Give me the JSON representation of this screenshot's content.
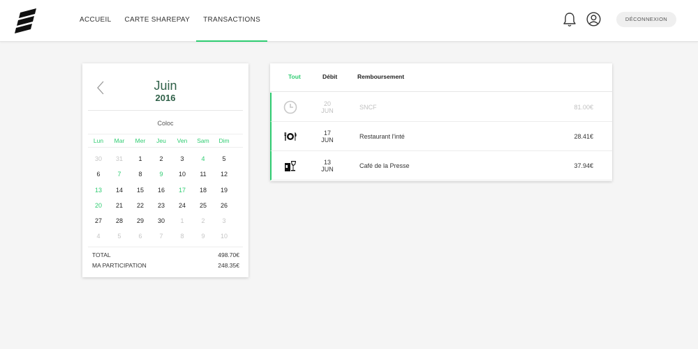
{
  "header": {
    "nav": [
      {
        "label": "ACCUEIL",
        "active": false
      },
      {
        "label": "CARTE SHAREPAY",
        "active": false
      },
      {
        "label": "TRANSACTIONS",
        "active": true
      }
    ],
    "logout_label": "DÉCONNEXION",
    "accent": "#2ecc71"
  },
  "calendar": {
    "month": "Juin",
    "year": "2016",
    "group": "Coloc",
    "weekdays": [
      "Lun",
      "Mar",
      "Mer",
      "Jeu",
      "Ven",
      "Sam",
      "Dim"
    ],
    "weeks": [
      [
        {
          "d": "30",
          "s": "muted"
        },
        {
          "d": "31",
          "s": "muted"
        },
        {
          "d": "1",
          "s": ""
        },
        {
          "d": "2",
          "s": ""
        },
        {
          "d": "3",
          "s": ""
        },
        {
          "d": "4",
          "s": "green"
        },
        {
          "d": "5",
          "s": ""
        }
      ],
      [
        {
          "d": "6",
          "s": ""
        },
        {
          "d": "7",
          "s": "green"
        },
        {
          "d": "8",
          "s": ""
        },
        {
          "d": "9",
          "s": "green"
        },
        {
          "d": "10",
          "s": ""
        },
        {
          "d": "11",
          "s": ""
        },
        {
          "d": "12",
          "s": ""
        }
      ],
      [
        {
          "d": "13",
          "s": "green"
        },
        {
          "d": "14",
          "s": ""
        },
        {
          "d": "15",
          "s": ""
        },
        {
          "d": "16",
          "s": ""
        },
        {
          "d": "17",
          "s": "green"
        },
        {
          "d": "18",
          "s": ""
        },
        {
          "d": "19",
          "s": ""
        }
      ],
      [
        {
          "d": "20",
          "s": "green"
        },
        {
          "d": "21",
          "s": ""
        },
        {
          "d": "22",
          "s": ""
        },
        {
          "d": "23",
          "s": ""
        },
        {
          "d": "24",
          "s": ""
        },
        {
          "d": "25",
          "s": ""
        },
        {
          "d": "26",
          "s": ""
        }
      ],
      [
        {
          "d": "27",
          "s": ""
        },
        {
          "d": "28",
          "s": ""
        },
        {
          "d": "29",
          "s": ""
        },
        {
          "d": "30",
          "s": ""
        },
        {
          "d": "1",
          "s": "muted"
        },
        {
          "d": "2",
          "s": "muted"
        },
        {
          "d": "3",
          "s": "muted"
        }
      ],
      [
        {
          "d": "4",
          "s": "muted"
        },
        {
          "d": "5",
          "s": "muted"
        },
        {
          "d": "6",
          "s": "muted"
        },
        {
          "d": "7",
          "s": "muted"
        },
        {
          "d": "8",
          "s": "muted"
        },
        {
          "d": "9",
          "s": "muted"
        },
        {
          "d": "10",
          "s": "muted"
        }
      ]
    ],
    "total_label": "TOTAL",
    "total_value": "498.70€",
    "participation_label": "MA PARTICIPATION",
    "participation_value": "248.35€"
  },
  "transactions": {
    "tabs": [
      "Tout",
      "Débit",
      "Remboursement"
    ],
    "active_tab": "Tout",
    "rows": [
      {
        "icon": "clock-icon",
        "day": "20",
        "month": "JUN",
        "name": "SNCF",
        "amount": "81.00€",
        "pending": true
      },
      {
        "icon": "restaurant-icon",
        "day": "17",
        "month": "JUN",
        "name": "Restaurant l'inté",
        "amount": "28.41€",
        "pending": false
      },
      {
        "icon": "bar-icon",
        "day": "13",
        "month": "JUN",
        "name": "Café de la Presse",
        "amount": "37.94€",
        "pending": false
      }
    ]
  }
}
